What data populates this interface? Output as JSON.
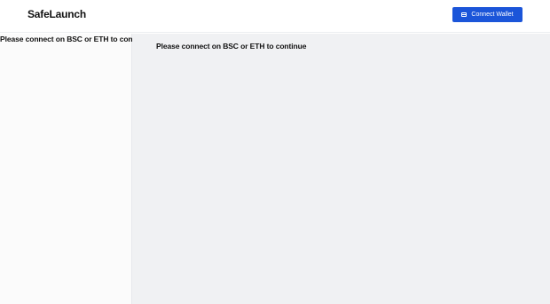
{
  "header": {
    "brand": "SafeLaunch",
    "connect_button": {
      "label": "Connect Wallet",
      "icon": "wallet-icon",
      "color": "#1b55d9"
    }
  },
  "sidebar": {
    "message": "Please connect on BSC or ETH to continue"
  },
  "main": {
    "message": "Please connect on BSC or ETH to continue"
  }
}
